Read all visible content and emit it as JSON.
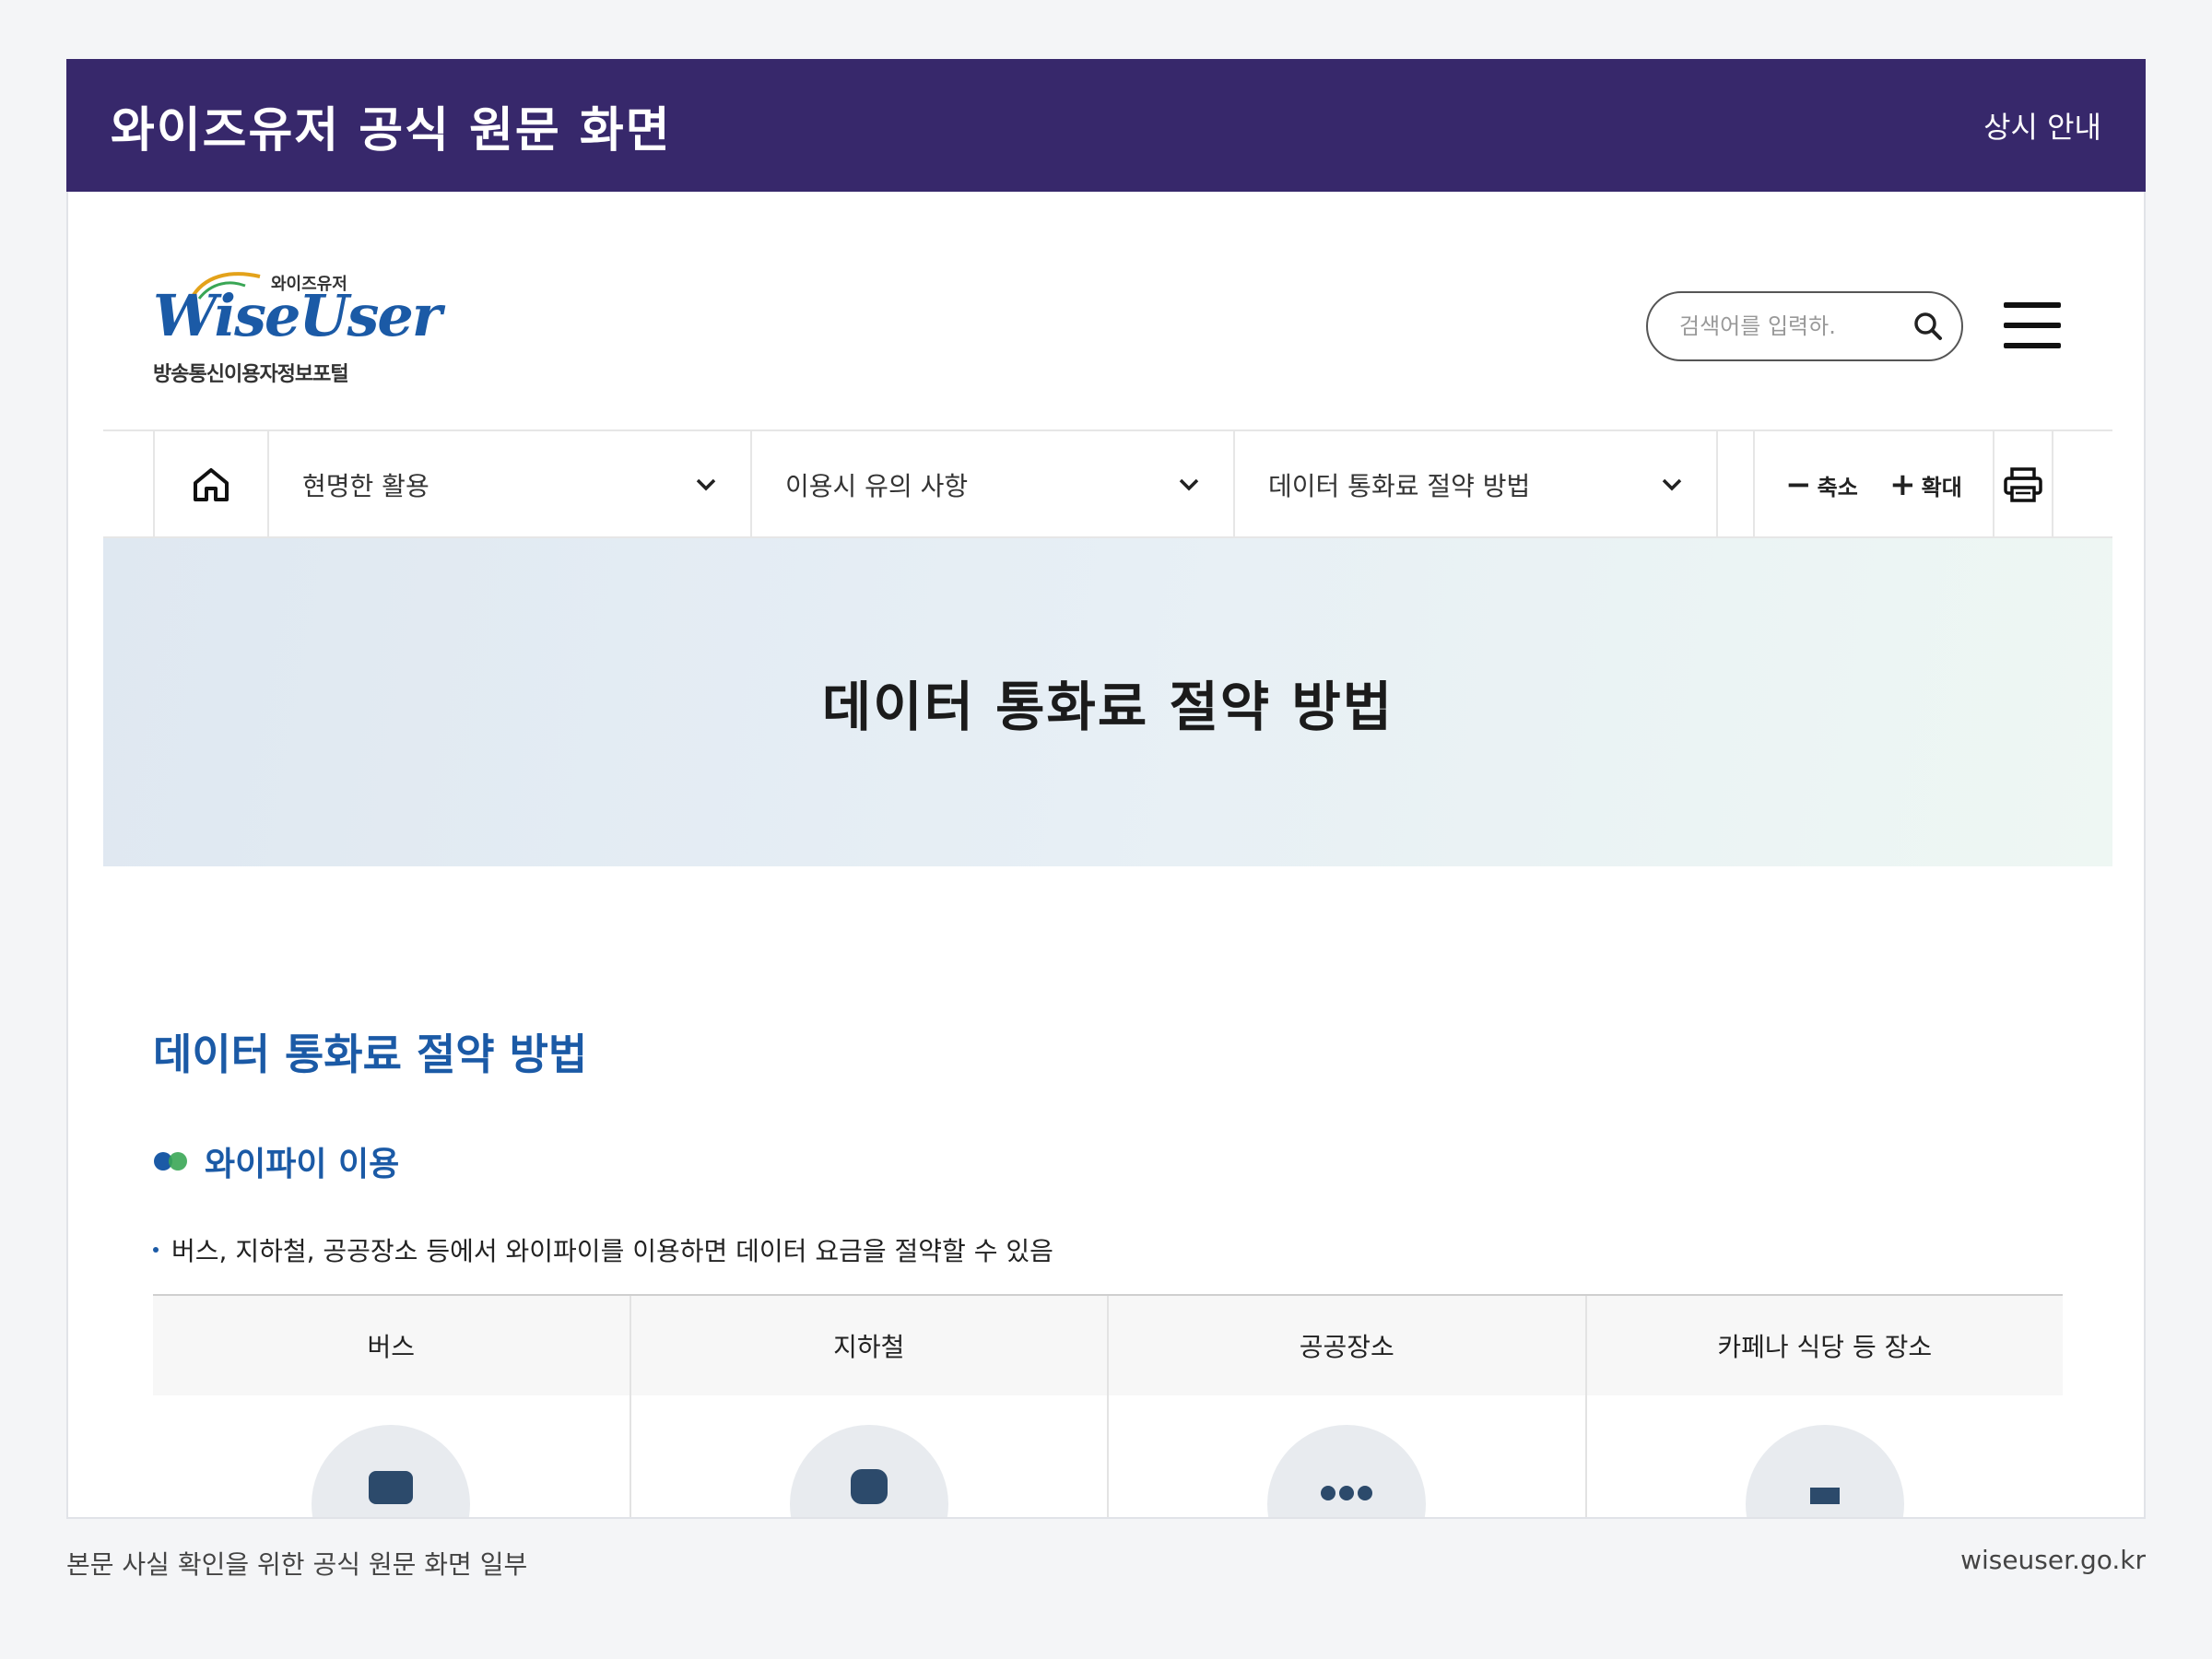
{
  "frame": {
    "title": "와이즈유저 공식 원문 화면",
    "notice": "상시 안내",
    "caption": "본문 사실 확인을 위한 공식 원문 화면 일부",
    "source": "wiseuser.go.kr"
  },
  "logo": {
    "korean": "와이즈유저",
    "english": "WiseUser",
    "subtitle": "방송통신이용자정보포털"
  },
  "search": {
    "placeholder": "검색어를 입력하."
  },
  "nav": {
    "items": [
      {
        "label": "현명한 활용"
      },
      {
        "label": "이용시 유의 사항"
      },
      {
        "label": "데이터 통화료 절약 방법"
      }
    ],
    "zoom_out_label": "축소",
    "zoom_in_label": "확대"
  },
  "banner": {
    "title": "데이터 통화료 절약 방법"
  },
  "content": {
    "title": "데이터 통화료 절약 방법",
    "section_title": "와이파이 이용",
    "bullet": "버스, 지하철, 공공장소 등에서 와이파이를 이용하면 데이터 요금을 절약할 수 있음",
    "table_headers": [
      "버스",
      "지하철",
      "공공장소",
      "카페나 식당 등 장소"
    ]
  },
  "colors": {
    "header_bg": "#37286b",
    "accent_blue": "#1b5aa6",
    "accent_green": "#3aa655"
  },
  "icons": {
    "home": "home-icon",
    "search": "search-icon",
    "menu": "hamburger-menu-icon",
    "print": "printer-icon",
    "chevron": "chevron-down-icon"
  }
}
